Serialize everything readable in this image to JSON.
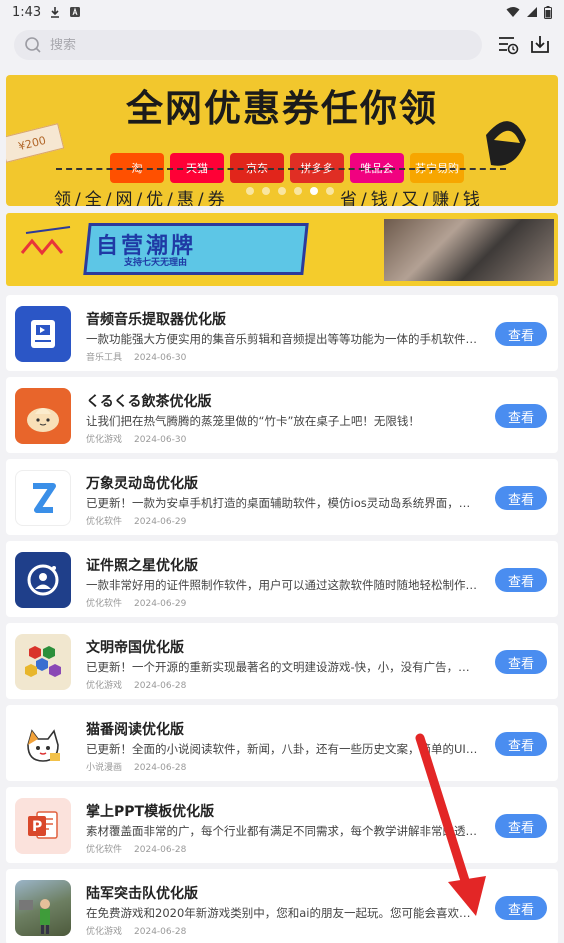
{
  "status_bar": {
    "time": "1:43"
  },
  "search": {
    "placeholder": "搜索"
  },
  "banner1": {
    "title": "全网优惠券任你领",
    "coupon": "¥200",
    "platforms": [
      "淘",
      "天猫",
      "京东",
      "拼多多",
      "唯品会",
      "苏宁易购"
    ],
    "bottom_left": "领/全/网/优/惠/券",
    "bottom_right": "省/钱/又/赚/钱"
  },
  "banner2": {
    "title": "自营潮牌",
    "subtitle": "支持七天无理由"
  },
  "apps": [
    {
      "name": "音频音乐提取器优化版",
      "desc": "一款功能强大方便实用的集音乐剪辑和音频提出等等功能为一体的手机软件，…",
      "category": "音乐工具",
      "date": "2024-06-30",
      "button": "查看"
    },
    {
      "name": "くるくる飲茶优化版",
      "desc": "让我们把在热气腾腾的蒸笼里做的“竹卡”放在桌子上吧！无限钱！",
      "category": "优化游戏",
      "date": "2024-06-30",
      "button": "查看"
    },
    {
      "name": "万象灵动岛优化版",
      "desc": "已更新！一款为安卓手机打造的桌面辅助软件，模仿ios灵动岛系统界面，功能…",
      "category": "优化软件",
      "date": "2024-06-29",
      "button": "查看"
    },
    {
      "name": "证件照之星优化版",
      "desc": "一款非常好用的证件照制作软件，用户可以通过这款软件随时随地轻松制作证…",
      "category": "优化软件",
      "date": "2024-06-29",
      "button": "查看"
    },
    {
      "name": "文明帝国优化版",
      "desc": "已更新！一个开源的重新实现最著名的文明建设游戏-快，小，没有广告，永远…",
      "category": "优化游戏",
      "date": "2024-06-28",
      "button": "查看"
    },
    {
      "name": "猫番阅读优化版",
      "desc": "已更新！全面的小说阅读软件，新闻，八卦，还有一些历史文案，简单的UI页…",
      "category": "小说漫画",
      "date": "2024-06-28",
      "button": "查看"
    },
    {
      "name": "掌上PPT模板优化版",
      "desc": "素材覆盖面非常的广，每个行业都有满足不同需求，每个教学讲解非常的透彻…",
      "category": "优化软件",
      "date": "2024-06-28",
      "button": "查看"
    },
    {
      "name": "陆军突击队优化版",
      "desc": "在免费游戏和2020年新游戏类别中，您和ai的朋友一起玩。您可能会喜欢的游…",
      "category": "优化游戏",
      "date": "2024-06-28",
      "button": "查看"
    }
  ],
  "colors": {
    "accent": "#4a8df0",
    "banner_yellow": "#f2c72d",
    "annotation_arrow": "#e32626"
  }
}
